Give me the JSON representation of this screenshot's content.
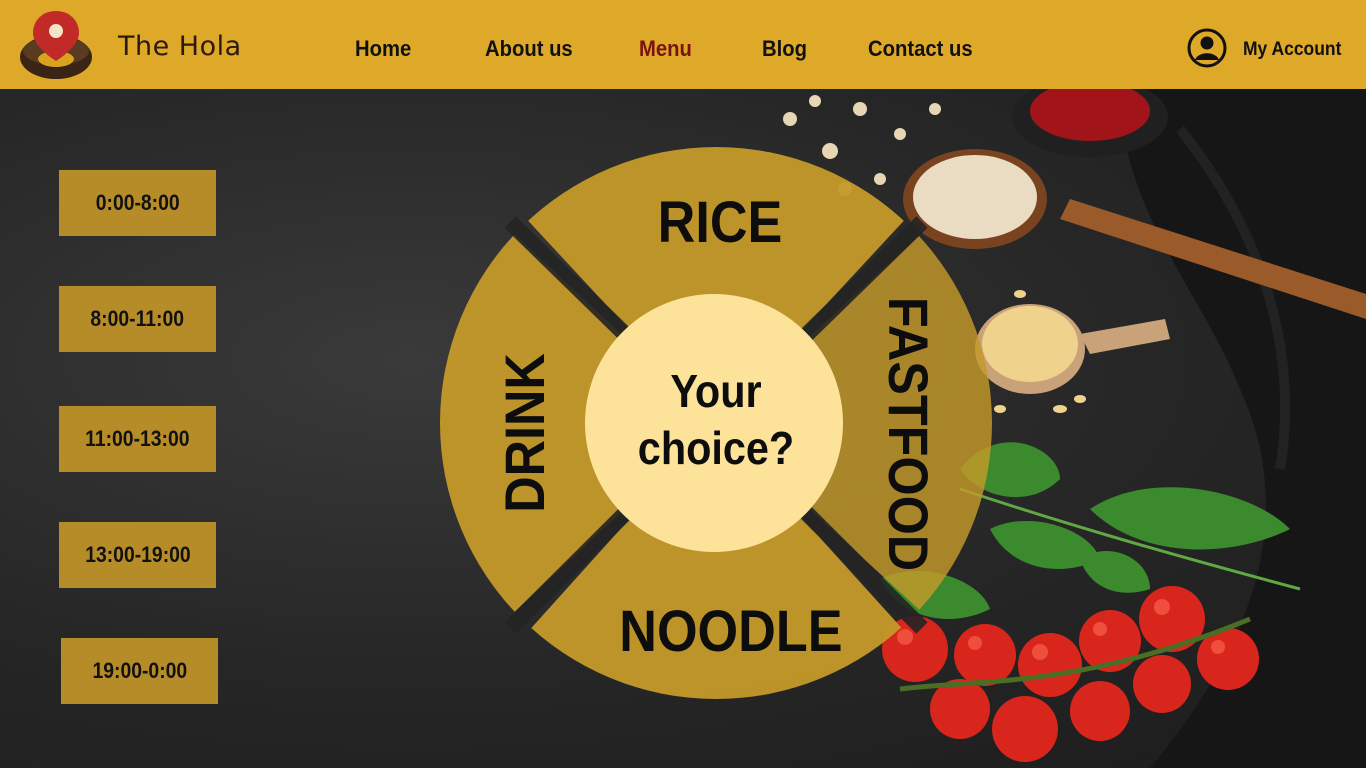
{
  "header": {
    "brand": "The Hola",
    "nav": [
      {
        "label": "Home"
      },
      {
        "label": "About us"
      },
      {
        "label": "Menu",
        "active": true
      },
      {
        "label": "Blog"
      },
      {
        "label": "Contact us"
      }
    ],
    "account_label": "My Account"
  },
  "time_slots": [
    "0:00-8:00",
    "8:00-11:00",
    "11:00-13:00",
    "13:00-19:00",
    "19:00-0:00"
  ],
  "wheel": {
    "top": "RICE",
    "right": "FASTFOOD",
    "bottom": "NOODLE",
    "left": "DRINK",
    "center_line1": "Your",
    "center_line2": "choice?"
  },
  "colors": {
    "header_bg": "#dea828",
    "active_nav": "#7a1210",
    "segment": "#c49a2a",
    "center": "#fde29a",
    "slot": "#b68c28"
  },
  "icons": [
    "logo-pin-bowl-icon",
    "user-account-icon"
  ]
}
